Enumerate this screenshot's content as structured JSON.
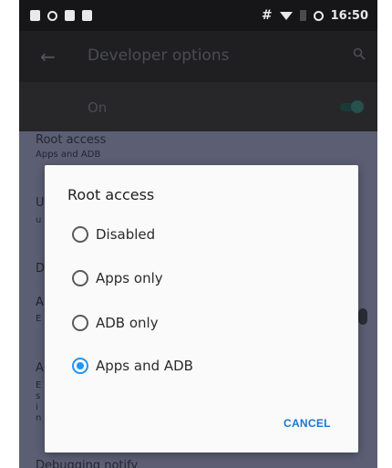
{
  "status_bar": {
    "hash_icon_label": "#",
    "time": "16:50"
  },
  "toolbar": {
    "title": "Developer options"
  },
  "master_switch": {
    "label": "On"
  },
  "background_items": {
    "root_access_title": "Root access",
    "root_access_summary": "Apps and ADB",
    "item_u": "U",
    "item_u2": "u",
    "item_d": "D",
    "item_a": "A",
    "item_e": "E",
    "item_a2": "A",
    "item_e2": "E",
    "item_s": "s",
    "item_i": "i",
    "item_n": "n",
    "debugging_notify": "Debugging notify"
  },
  "dialog": {
    "title": "Root access",
    "options": [
      {
        "label": "Disabled",
        "checked": false
      },
      {
        "label": "Apps only",
        "checked": false
      },
      {
        "label": "ADB only",
        "checked": false
      },
      {
        "label": "Apps and ADB",
        "checked": true
      }
    ],
    "cancel_label": "CANCEL"
  },
  "colors": {
    "accent": "#2196f3",
    "dialog_bg": "#fafafa"
  }
}
